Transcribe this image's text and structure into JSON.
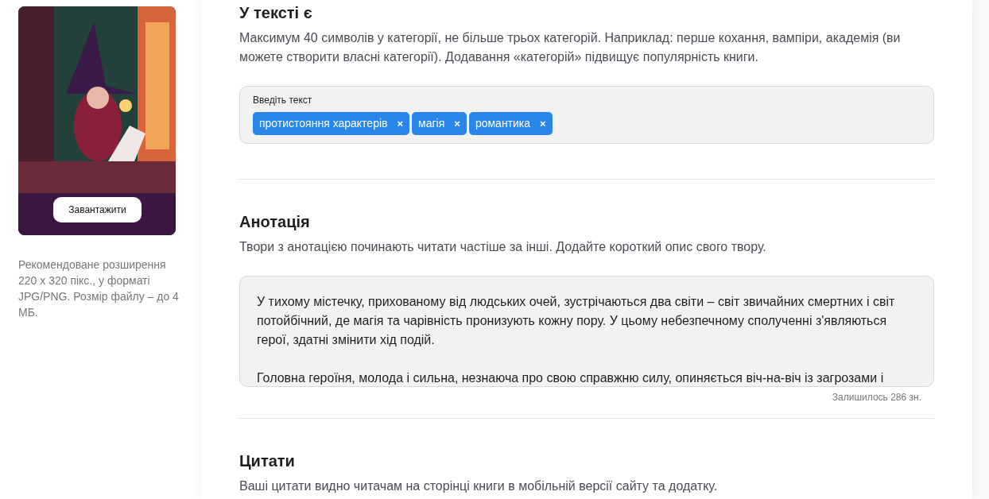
{
  "cover": {
    "kind": "picture",
    "upload_button": "Завантажити",
    "hint": "Рекомендоване розширення 220 x 320 пікс., у форматі JPG/PNG. Розмір файлу – до 4 МБ."
  },
  "sections": [
    {
      "kind": "tags",
      "title": "У тексті є",
      "description": "Максимум 40 символів у категорії, не більше трьох категорій. Наприклад: перше кохання, вампіри, академія (ви можете створити власні категорії). Додавання «категорій» підвищує популярність книги.",
      "field_label": "Введіть текст",
      "tags": [
        {
          "label": "протистояння характерів",
          "remove": "×"
        },
        {
          "label": "магія",
          "remove": "×"
        },
        {
          "label": "романтика",
          "remove": "×"
        }
      ]
    },
    {
      "kind": "textarea",
      "title": "Анотація",
      "description": "Твори з анотацією починають читати частіше за інші. Додайте короткий опис свого твору.",
      "paragraphs": [
        "У тихому містечку, прихованому від людських очей, зустрічаються два світи – світ звичайних смертних і світ потойбічний, де магія та чарівність пронизують кожну пору. У цьому небезпечному сполученні з'являються герої, здатні змінити хід подій.",
        "Головна героїня, молода і сильна, незнаюча про свою справжню силу, опиняється віч-на-віч із загрозами і"
      ],
      "counter": "Залишилось 286 зн."
    },
    {
      "kind": "heading",
      "title": "Цитати",
      "description": "Ваші цитати видно читачам на сторінці книги в мобільній версії сайту та додатку."
    }
  ]
}
